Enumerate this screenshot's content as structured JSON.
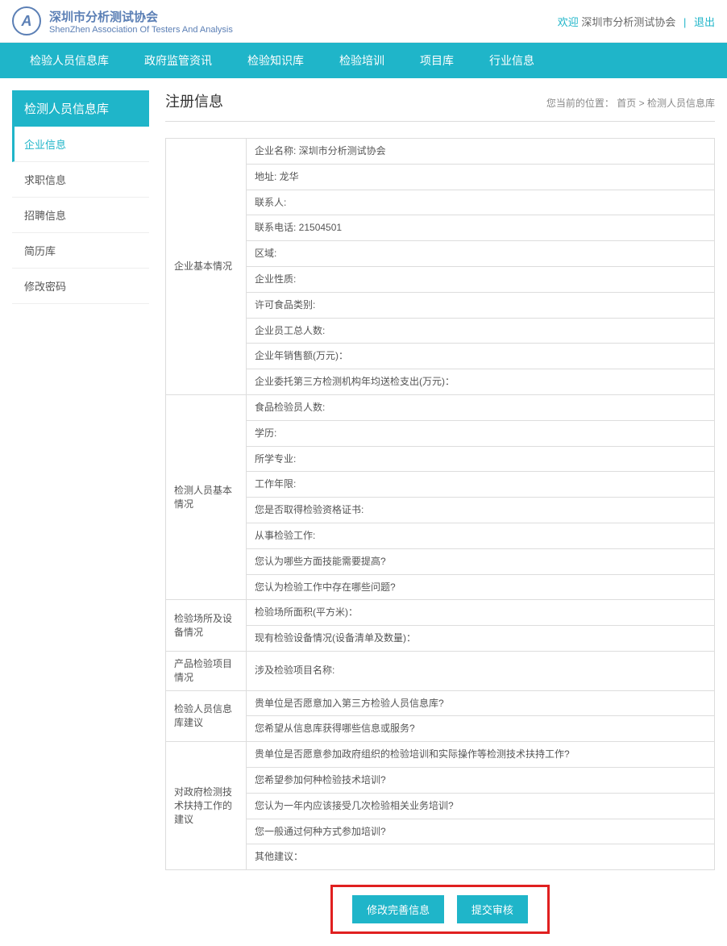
{
  "header": {
    "logo_cn": "深圳市分析测试协会",
    "logo_en": "ShenZhen Association Of Testers And Analysis",
    "welcome_label": "欢迎",
    "welcome_name": "深圳市分析测试协会",
    "logout": "退出"
  },
  "nav": {
    "items": [
      "检验人员信息库",
      "政府监管资讯",
      "检验知识库",
      "检验培训",
      "项目库",
      "行业信息"
    ]
  },
  "sidebar": {
    "title": "检测人员信息库",
    "items": [
      "企业信息",
      "求职信息",
      "招聘信息",
      "简历库",
      "修改密码"
    ]
  },
  "page": {
    "title": "注册信息",
    "breadcrumb_label": "您当前的位置：",
    "breadcrumb_home": "首页",
    "breadcrumb_sep": " > ",
    "breadcrumb_current": "检测人员信息库"
  },
  "sections": [
    {
      "label": "企业基本情况",
      "rows": [
        {
          "label": "企业名称:",
          "value": "深圳市分析测试协会"
        },
        {
          "label": "地址:",
          "value": "龙华"
        },
        {
          "label": "联系人:",
          "value": ""
        },
        {
          "label": "联系电话:",
          "value": "21504501"
        },
        {
          "label": "区域:",
          "value": ""
        },
        {
          "label": "企业性质:",
          "value": ""
        },
        {
          "label": "许可食品类别:",
          "value": ""
        },
        {
          "label": "企业员工总人数:",
          "value": ""
        },
        {
          "label": "企业年销售额(万元)：",
          "value": ""
        },
        {
          "label": "企业委托第三方检测机构年均送检支出(万元)：",
          "value": ""
        }
      ]
    },
    {
      "label": "检测人员基本情况",
      "rows": [
        {
          "label": "食品检验员人数:",
          "value": ""
        },
        {
          "label": "学历:",
          "value": ""
        },
        {
          "label": "所学专业:",
          "value": ""
        },
        {
          "label": "工作年限:",
          "value": ""
        },
        {
          "label": "您是否取得检验资格证书:",
          "value": ""
        },
        {
          "label": "从事检验工作:",
          "value": ""
        },
        {
          "label": "您认为哪些方面技能需要提高?",
          "value": ""
        },
        {
          "label": "您认为检验工作中存在哪些问题?",
          "value": ""
        }
      ]
    },
    {
      "label": "检验场所及设备情况",
      "rows": [
        {
          "label": "检验场所面积(平方米)：",
          "value": ""
        },
        {
          "label": "现有检验设备情况(设备清单及数量)：",
          "value": ""
        }
      ]
    },
    {
      "label": "产品检验项目情况",
      "rows": [
        {
          "label": "涉及检验项目名称:",
          "value": ""
        }
      ]
    },
    {
      "label": "检验人员信息库建议",
      "rows": [
        {
          "label": "贵单位是否愿意加入第三方检验人员信息库?",
          "value": ""
        },
        {
          "label": "您希望从信息库获得哪些信息或服务?",
          "value": ""
        }
      ]
    },
    {
      "label": "对政府检测技术扶持工作的建议",
      "rows": [
        {
          "label": "贵单位是否愿意参加政府组织的检验培训和实际操作等检测技术扶持工作?",
          "value": ""
        },
        {
          "label": "您希望参加何种检验技术培训?",
          "value": ""
        },
        {
          "label": "您认为一年内应该接受几次检验相关业务培训?",
          "value": ""
        },
        {
          "label": "您一般通过何种方式参加培训?",
          "value": ""
        },
        {
          "label": "其他建议：",
          "value": ""
        }
      ]
    }
  ],
  "buttons": {
    "edit": "修改完善信息",
    "submit": "提交审核"
  }
}
